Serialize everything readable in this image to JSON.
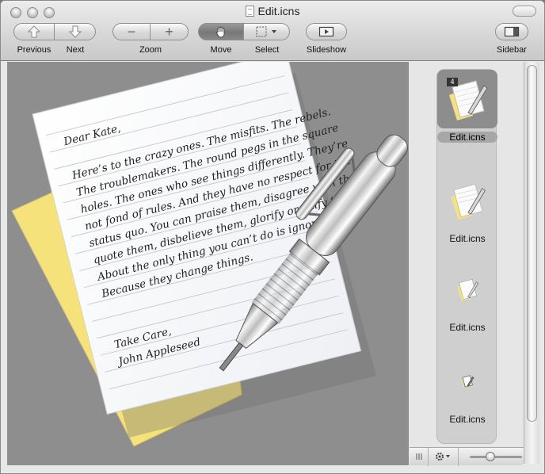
{
  "window": {
    "title": "Edit.icns"
  },
  "toolbar": {
    "previous_label": "Previous",
    "next_label": "Next",
    "zoom_label": "Zoom",
    "move_label": "Move",
    "select_label": "Select",
    "slideshow_label": "Slideshow",
    "sidebar_label": "Sidebar",
    "zoom_out_glyph": "−",
    "zoom_in_glyph": "+"
  },
  "letter": {
    "greeting": "Dear Kate,",
    "lines": [
      "Here’s to the crazy ones. The misfits. The rebels.",
      "The troublemakers. The round pegs in the square",
      "holes. The ones who see things differently. They’re",
      "not fond of rules. And they have no respect for the",
      "status quo. You can praise them, disagree with them,",
      "quote them, disbelieve them, glorify or vilify them.",
      "About the only thing you can’t do is ignore them.",
      "Because they change things."
    ],
    "closing": "Take Care,",
    "signature": "John Appleseed"
  },
  "sidebar": {
    "items": [
      {
        "label": "Edit.icns",
        "badge": "4",
        "selected": true
      },
      {
        "label": "Edit.icns",
        "selected": false
      },
      {
        "label": "Edit.icns",
        "selected": false
      },
      {
        "label": "Edit.icns",
        "selected": false
      }
    ]
  },
  "colors": {
    "content_bg": "#8e8e8e",
    "sticky_note": "#f6e27a",
    "paper": "#fbfbfc",
    "ruled_line": "#c9ccd6"
  },
  "icons": {
    "previous": "arrow-up-icon",
    "next": "arrow-down-icon",
    "move": "hand-icon",
    "select": "marquee-select-icon",
    "slideshow": "play-screen-icon",
    "sidebar": "sidebar-icon",
    "action": "gear-icon",
    "columns": "grip-icon"
  }
}
